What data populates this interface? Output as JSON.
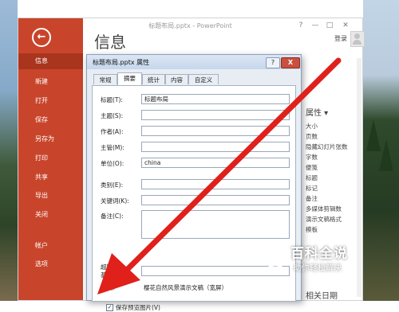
{
  "window": {
    "title": "标题布局.pptx - PowerPoint",
    "login_label": "登录",
    "help_glyph": "?",
    "minimize_glyph": "—",
    "restore_glyph": "□",
    "close_glyph": "✕"
  },
  "backstage": {
    "back_glyph": "←",
    "items": [
      {
        "label": "信息",
        "active": true
      },
      {
        "label": "新建"
      },
      {
        "label": "打开"
      },
      {
        "label": "保存"
      },
      {
        "label": "另存为"
      },
      {
        "label": "打印"
      },
      {
        "label": "共享"
      },
      {
        "label": "导出"
      },
      {
        "label": "关闭"
      },
      {
        "label": "帐户"
      },
      {
        "label": "选项"
      }
    ],
    "page_heading": "信息",
    "accent_color": "#c8452c"
  },
  "properties_pane": {
    "title": "属性 ▾",
    "items": [
      "大小",
      "页数",
      "隐藏幻灯片张数",
      "字数",
      "便笺",
      "标题",
      "标记",
      "备注",
      "多媒体剪辑数",
      "演示文稿格式",
      "模板"
    ],
    "related_dates": "相关日期"
  },
  "dialog": {
    "title": "标题布局.pptx 属性",
    "help_glyph": "?",
    "close_glyph": "X",
    "tabs": [
      "常规",
      "摘要",
      "统计",
      "内容",
      "自定义"
    ],
    "active_tab": "摘要",
    "fields": [
      {
        "label": "标题(T):",
        "value": "标题布局"
      },
      {
        "label": "主题(S):",
        "value": ""
      },
      {
        "label": "作者(A):",
        "value": ""
      },
      {
        "label": "主管(M):",
        "value": ""
      },
      {
        "label": "单位(O):",
        "value": "china"
      },
      {
        "label": "类别(E):",
        "value": ""
      },
      {
        "label": "关键词(K):",
        "value": ""
      }
    ],
    "notes_label": "备注(C):",
    "hyperlink_base_label_1": "超链接",
    "hyperlink_base_label_2": "基础(H):",
    "template_label": "模板:",
    "template_value": "樱花自然风景演示文稿（宽屏）",
    "save_preview_label": "保存预览图片(V)",
    "save_preview_checked": true
  },
  "watermark": {
    "title": "百科全说",
    "subtitle": "助你轻松解决"
  }
}
